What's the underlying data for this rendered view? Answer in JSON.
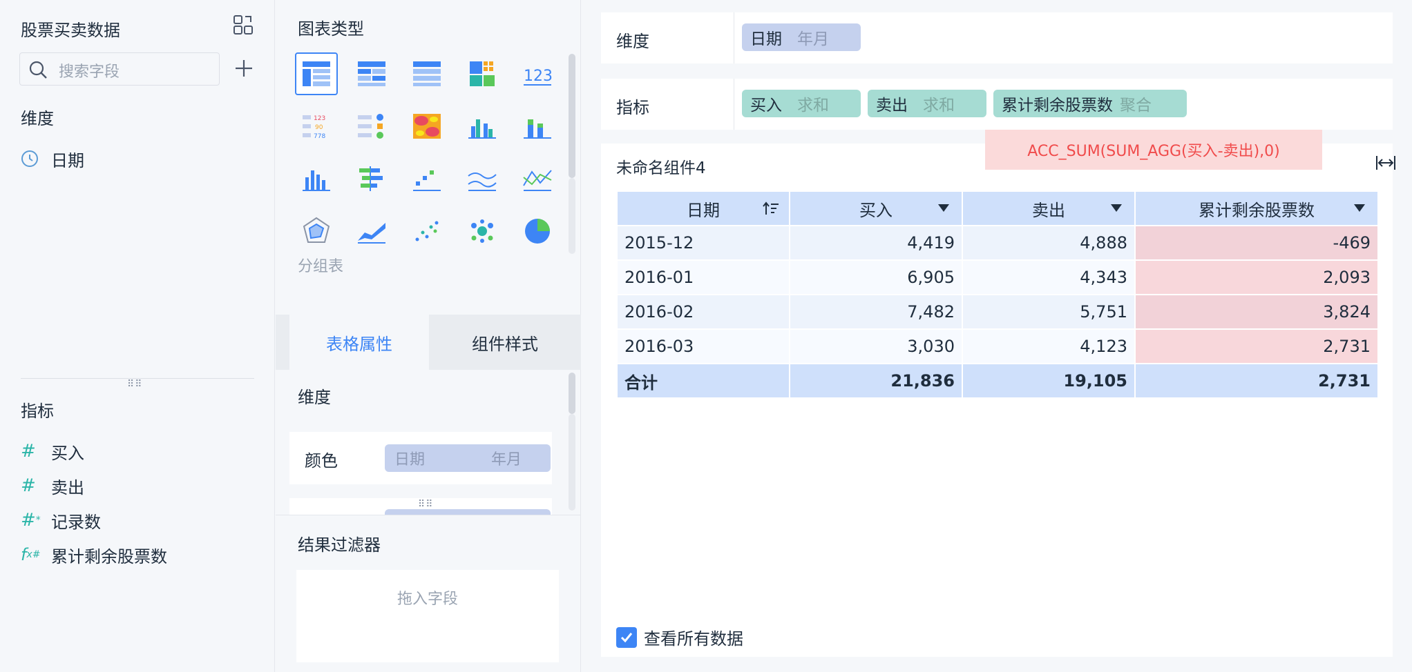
{
  "left_panel": {
    "title": "股票买卖数据",
    "search_placeholder": "搜索字段",
    "dimension_label": "维度",
    "dimensions": [
      {
        "label": "日期",
        "icon": "clock-icon"
      }
    ],
    "measure_label": "指标",
    "measures": [
      {
        "label": "买入",
        "icon": "#"
      },
      {
        "label": "卖出",
        "icon": "#"
      },
      {
        "label": "记录数",
        "icon": "#*"
      },
      {
        "label": "累计剩余股票数",
        "icon": "fx"
      }
    ]
  },
  "middle_panel": {
    "chart_type_title": "图表类型",
    "selected_chart_name": "分组表",
    "tabs": [
      "表格属性",
      "组件样式"
    ],
    "dimension_label": "维度",
    "color_label": "颜色",
    "color_pill": {
      "field": "日期",
      "agg": "年月"
    },
    "filter_title": "结果过滤器",
    "drop_placeholder": "拖入字段"
  },
  "shelves": {
    "dimension_label": "维度",
    "dimension_pills": [
      {
        "field": "日期",
        "agg": "年月"
      }
    ],
    "measure_label": "指标",
    "measure_pills": [
      {
        "field": "买入",
        "agg": "求和"
      },
      {
        "field": "卖出",
        "agg": "求和"
      },
      {
        "field": "累计剩余股票数",
        "agg": "聚合"
      }
    ]
  },
  "widget": {
    "name": "未命名组件4",
    "formula": "ACC_SUM(SUM_AGG(买入-卖出),0)",
    "columns": [
      "日期",
      "买入",
      "卖出",
      "累计剩余股票数"
    ],
    "rows": [
      [
        "2015-12",
        "4,419",
        "4,888",
        "-469"
      ],
      [
        "2016-01",
        "6,905",
        "4,343",
        "2,093"
      ],
      [
        "2016-02",
        "7,482",
        "5,751",
        "3,824"
      ],
      [
        "2016-03",
        "3,030",
        "4,123",
        "2,731"
      ]
    ],
    "total": [
      "合计",
      "21,836",
      "19,105",
      "2,731"
    ],
    "view_all_label": "查看所有数据",
    "view_all_checked": true
  },
  "colors": {
    "accent": "#3d85f5",
    "highlight": "#f8d7db",
    "formula_text": "#f04b4b"
  }
}
